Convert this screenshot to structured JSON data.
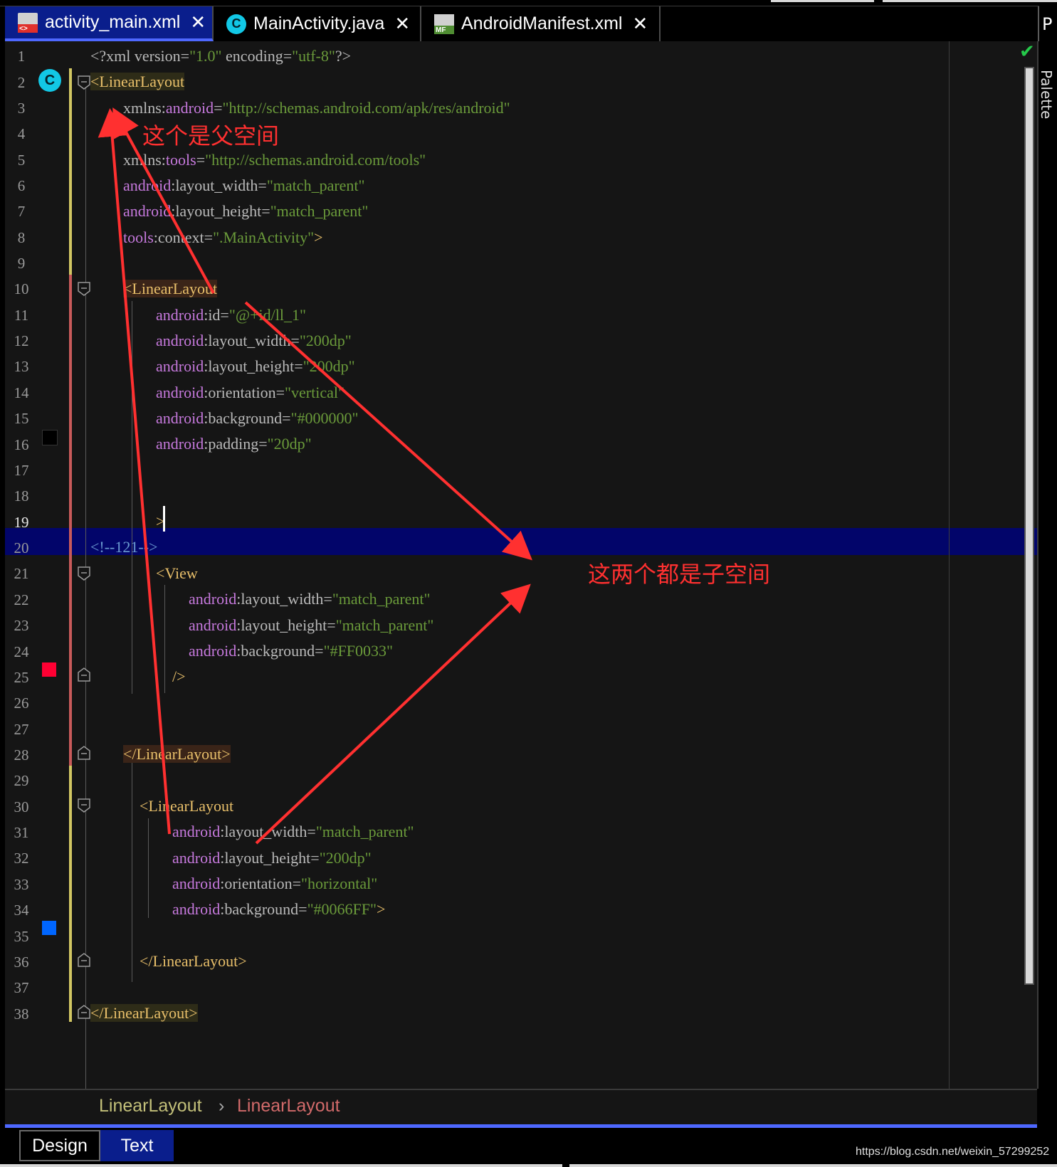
{
  "tabs": [
    {
      "label": "activity_main.xml",
      "icon": "xml-file-icon",
      "active": true
    },
    {
      "label": "MainActivity.java",
      "icon": "java-class-icon",
      "active": false
    },
    {
      "label": "AndroidManifest.xml",
      "icon": "manifest-file-icon",
      "active": false
    }
  ],
  "tab_close_glyph": "✕",
  "side_tab_label": "P",
  "palette_label": "Palette",
  "gutter_class_badge": "C",
  "line_numbers": [
    "1",
    "2",
    "3",
    "4",
    "5",
    "6",
    "7",
    "8",
    "9",
    "10",
    "11",
    "12",
    "13",
    "14",
    "15",
    "16",
    "17",
    "18",
    "19",
    "20",
    "21",
    "22",
    "23",
    "24",
    "25",
    "26",
    "27",
    "28",
    "29",
    "30",
    "31",
    "32",
    "33",
    "34",
    "35",
    "36",
    "37",
    "38"
  ],
  "current_line": "19",
  "code": {
    "l1_a": "<?xml version=",
    "l1_b": "\"1.0\"",
    "l1_c": " encoding=",
    "l1_d": "\"utf-8\"",
    "l1_e": "?>",
    "l2": "<LinearLayout",
    "l3_a": "xmlns:",
    "l3_b": "android",
    "l3_c": "=",
    "l3_d": "\"http://schemas.android.com/apk/res/android\"",
    "l5_a": "xmlns:",
    "l5_b": "tools",
    "l5_c": "=",
    "l5_d": "\"http://schemas.android.com/tools\"",
    "l6_a": "android",
    "l6_b": ":layout_width=",
    "l6_c": "\"match_parent\"",
    "l7_a": "android",
    "l7_b": ":layout_height=",
    "l7_c": "\"match_parent\"",
    "l8_a": "tools",
    "l8_b": ":context=",
    "l8_c": "\".MainActivity\"",
    "l8_d": ">",
    "l10": "<LinearLayout",
    "l11_a": "android",
    "l11_b": ":id=",
    "l11_c": "\"@+id/ll_1\"",
    "l12_a": "android",
    "l12_b": ":layout_width=",
    "l12_c": "\"200dp\"",
    "l13_a": "android",
    "l13_b": ":layout_height=",
    "l13_c": "\"200dp\"",
    "l14_a": "android",
    "l14_b": ":orientation=",
    "l14_c": "\"vertical\"",
    "l15_a": "android",
    "l15_b": ":background=",
    "l15_c": "\"#000000\"",
    "l16_a": "android",
    "l16_b": ":padding=",
    "l16_c": "\"20dp\"",
    "l19": ">",
    "l20": "<!--121-->",
    "l21": "<View",
    "l22_a": "android",
    "l22_b": ":layout_width=",
    "l22_c": "\"match_parent\"",
    "l23_a": "android",
    "l23_b": ":layout_height=",
    "l23_c": "\"match_parent\"",
    "l24_a": "android",
    "l24_b": ":background=",
    "l24_c": "\"#FF0033\"",
    "l25": "/>",
    "l28": "</LinearLayout>",
    "l30": "<LinearLayout",
    "l31_a": "android",
    "l31_b": ":layout_width=",
    "l31_c": "\"match_parent\"",
    "l32_a": "android",
    "l32_b": ":layout_height=",
    "l32_c": "\"200dp\"",
    "l33_a": "android",
    "l33_b": ":orientation=",
    "l33_c": "\"horizontal\"",
    "l34_a": "android",
    "l34_b": ":background=",
    "l34_c": "\"#0066FF\"",
    "l34_d": ">",
    "l36": "</LinearLayout>",
    "l38": "</LinearLayout>"
  },
  "swatches": {
    "line15": "#000000",
    "line24": "#FF0033",
    "line34": "#0066FF"
  },
  "annotations": {
    "parent": "这个是父空间",
    "children": "这两个都是子空间"
  },
  "annotation_color": "#ff3030",
  "breadcrumb": {
    "first": "LinearLayout",
    "separator": "›",
    "second": "LinearLayout"
  },
  "bottom_tabs": {
    "design": "Design",
    "text": "Text",
    "active": "Text"
  },
  "watermark": "https://blog.csdn.net/weixin_57299252",
  "check_glyph": "✔"
}
